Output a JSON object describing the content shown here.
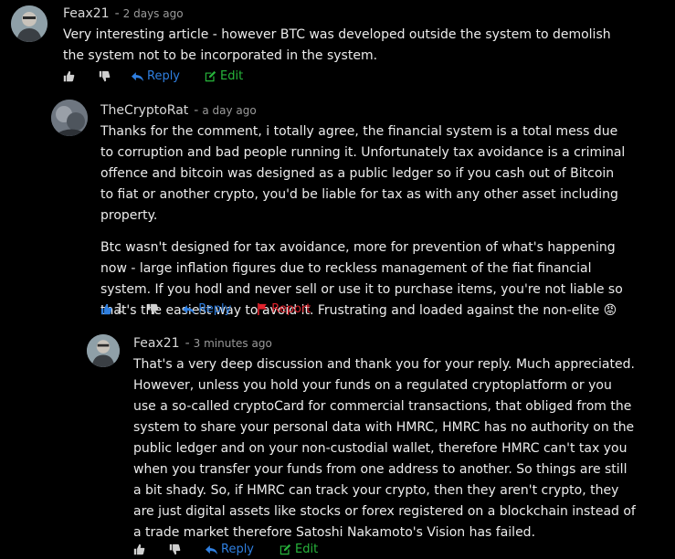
{
  "comments": [
    {
      "author": "Feax21",
      "separator": "-",
      "time": "2 days ago",
      "paragraphs": [
        "Very interesting article - however BTC was developed outside the system to demolish the system not to be incorporated in the system."
      ],
      "actions": {
        "like_count": "",
        "reply": "Reply",
        "second": "Edit"
      }
    },
    {
      "author": "TheCryptoRat",
      "separator": "-",
      "time": "a day ago",
      "paragraphs": [
        "Thanks for the comment, i totally agree, the financial system is a total mess due to corruption and bad people running it. Unfortunately tax avoidance is a criminal offence and bitcoin was designed as a public ledger so if you cash out of Bitcoin to fiat or another crypto, you'd be liable for tax as with any other asset including property.",
        "Btc wasn't designed for tax avoidance, more for prevention of what's happening now - large inflation figures due to reckless management of the fiat financial system. If you hodl and never sell or use it to purchase items, you're not liable so that's the easiest way to avoid it. Frustrating and loaded against the non-elite 😡"
      ],
      "actions": {
        "like_count": "1",
        "reply": "Reply",
        "second": "Report"
      }
    },
    {
      "author": "Feax21",
      "separator": "-",
      "time": "3 minutes ago",
      "paragraphs": [
        "That's a very deep discussion and thank you for your reply. Much appreciated. However, unless you hold your funds on a regulated cryptoplatform or you use a so-called cryptoCard for commercial transactions, that obliged from the system to share your personal data with HMRC, HMRC has no authority on the public ledger and on your non-custodial wallet, therefore HMRC can't tax you when you transfer your funds from one address to another. So things are still a bit shady. So, if HMRC can track your crypto, then they aren't crypto, they are just digital assets like stocks or forex registered on a blockchain instead of a trade market therefore Satoshi Nakamoto's Vision has failed."
      ],
      "actions": {
        "like_count": "",
        "reply": "Reply",
        "second": "Edit"
      }
    }
  ],
  "colors": {
    "reply": "#2f7fe0",
    "edit": "#27b53b",
    "report": "#e0222c",
    "like_active": "#2f7fe0"
  },
  "icons": {
    "like": "thumbs-up-icon",
    "dislike": "thumbs-down-icon",
    "reply": "reply-arrow-icon",
    "edit": "edit-icon",
    "report": "flag-icon"
  }
}
